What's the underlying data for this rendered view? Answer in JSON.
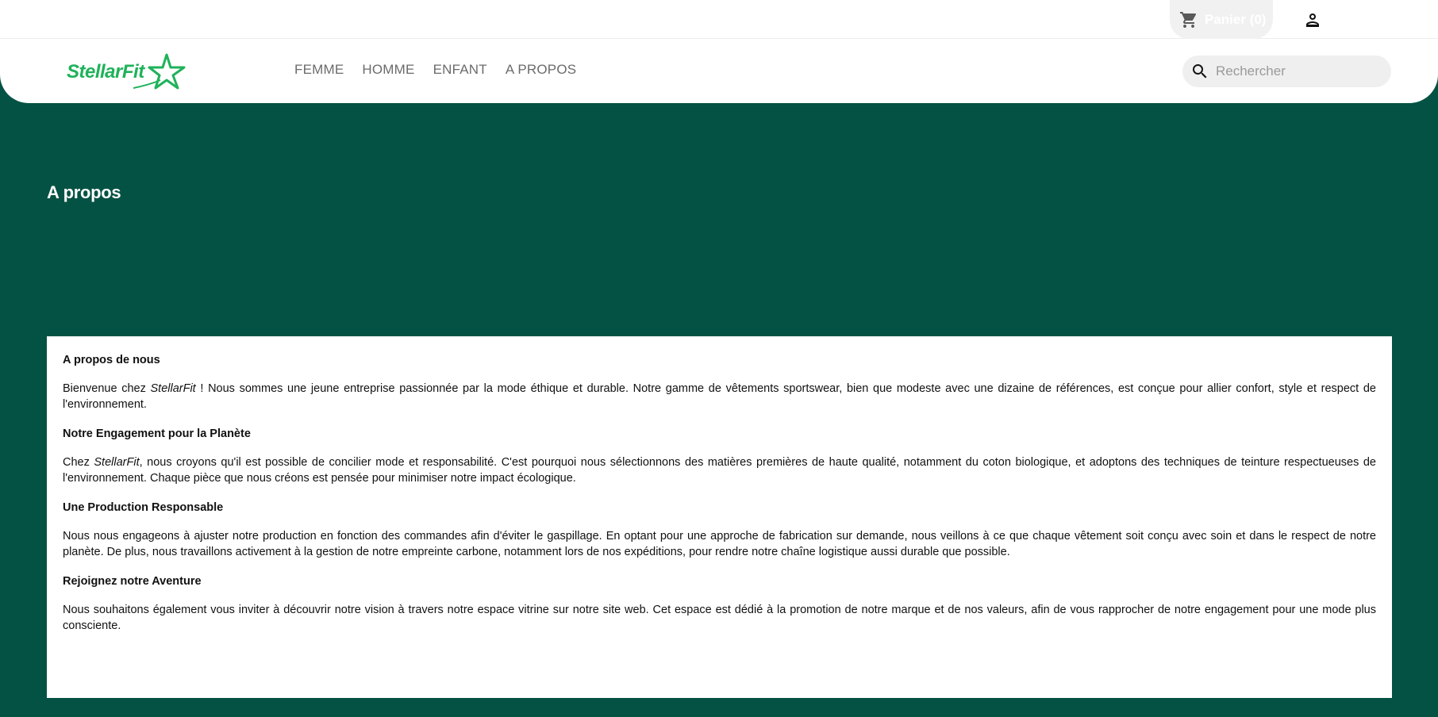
{
  "header": {
    "cart_label": "Panier (0)",
    "search_placeholder": "Rechercher"
  },
  "logo": {
    "text": "StellarFit"
  },
  "nav": {
    "items": [
      {
        "label": "FEMME"
      },
      {
        "label": "HOMME"
      },
      {
        "label": "ENFANT"
      },
      {
        "label": "A PROPOS"
      }
    ]
  },
  "page": {
    "title": "A propos"
  },
  "content": {
    "sections": [
      {
        "heading": "A propos de nous",
        "text_before": "Bienvenue chez ",
        "brand": "StellarFit",
        "text_after": " ! Nous sommes une jeune entreprise passionnée par la mode éthique et durable. Notre gamme de vêtements sportswear, bien que modeste avec une dizaine de références, est conçue pour allier confort, style et respect de l'environnement."
      },
      {
        "heading": "Notre Engagement pour la Planète",
        "text_before": "Chez ",
        "brand": "StellarFit",
        "text_after": ", nous croyons qu'il est possible de concilier mode et responsabilité. C'est pourquoi nous sélectionnons des matières premières de haute qualité, notamment du coton biologique, et adoptons des techniques de teinture respectueuses de l'environnement. Chaque pièce que nous créons est pensée pour minimiser notre impact écologique."
      },
      {
        "heading": "Une Production Responsable",
        "text_before": "Nous nous engageons à ajuster notre production en fonction des commandes afin d'éviter le gaspillage. En optant pour une approche de fabrication sur demande, nous veillons à ce que chaque vêtement soit conçu avec soin et dans le respect de notre planète. De plus, nous travaillons activement à la gestion de notre empreinte carbone, notamment lors de nos expéditions, pour rendre notre chaîne logistique aussi durable que possible.",
        "brand": "",
        "text_after": ""
      },
      {
        "heading": "Rejoignez notre Aventure",
        "text_before": "Nous souhaitons également vous inviter à découvrir notre vision à travers notre espace vitrine sur notre site web. Cet espace est dédié à la promotion de notre marque et de nos valeurs, afin de vous rapprocher de notre engagement pour une mode plus consciente.",
        "brand": "",
        "text_after": ""
      }
    ]
  },
  "colors": {
    "background": "#045243",
    "brand_green": "#1fb25a"
  }
}
